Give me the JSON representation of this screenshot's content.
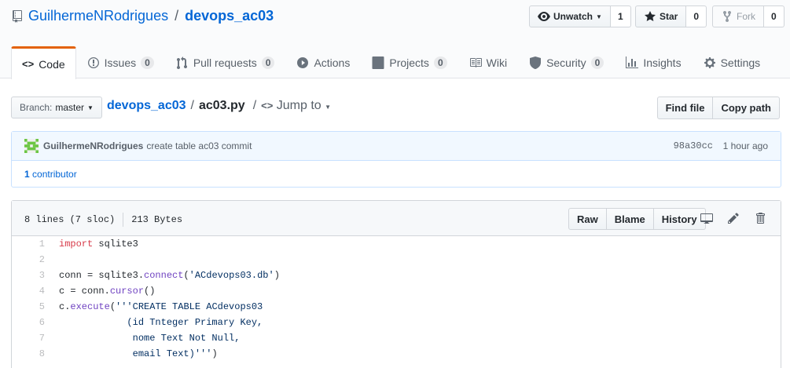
{
  "repo": {
    "owner": "GuilhermeNRodrigues",
    "separator": "/",
    "name": "devops_ac03"
  },
  "actions": {
    "watch": {
      "label": "Unwatch",
      "count": "1"
    },
    "star": {
      "label": "Star",
      "count": "0"
    },
    "fork": {
      "label": "Fork",
      "count": "0"
    }
  },
  "tabs": [
    {
      "label": "Code",
      "icon": "code-icon"
    },
    {
      "label": "Issues",
      "count": "0",
      "icon": "issue-icon"
    },
    {
      "label": "Pull requests",
      "count": "0",
      "icon": "pull-request-icon"
    },
    {
      "label": "Actions",
      "icon": "play-icon"
    },
    {
      "label": "Projects",
      "count": "0",
      "icon": "project-icon"
    },
    {
      "label": "Wiki",
      "icon": "book-icon"
    },
    {
      "label": "Security",
      "count": "0",
      "icon": "shield-icon"
    },
    {
      "label": "Insights",
      "icon": "graph-icon"
    },
    {
      "label": "Settings",
      "icon": "gear-icon"
    }
  ],
  "file_nav": {
    "branch_prefix": "Branch:",
    "branch": "master",
    "repo": "devops_ac03",
    "slash": "/",
    "file": "ac03.py",
    "jump_slash": "/",
    "jump": "Jump to",
    "find_file": "Find file",
    "copy_path": "Copy path"
  },
  "commit": {
    "author": "GuilhermeNRodrigues",
    "message": "create table ac03 commit",
    "sha": "98a30cc",
    "time": "1 hour ago",
    "contributors_count": "1",
    "contributors_label": "contributor"
  },
  "file": {
    "lines_info": "8 lines (7 sloc)",
    "size": "213 Bytes",
    "raw": "Raw",
    "blame": "Blame",
    "history": "History"
  },
  "code": {
    "line_numbers": [
      "1",
      "2",
      "3",
      "4",
      "5",
      "6",
      "7",
      "8"
    ],
    "l1_kw": "import",
    "l1_rest": " sqlite3",
    "l3_a": "conn = sqlite3.",
    "l3_fn": "connect",
    "l3_b": "(",
    "l3_str": "'ACdevops03.db'",
    "l3_c": ")",
    "l4_a": "c = conn.",
    "l4_fn": "cursor",
    "l4_b": "()",
    "l5_a": "c.",
    "l5_fn": "execute",
    "l5_b": "(",
    "l5_str": "'''CREATE TABLE ACdevops03",
    "l6_str": "            (id Tnteger Primary Key,",
    "l7_str": "             nome Text Not Null,",
    "l8_str": "             email Text)'''",
    "l8_c": ")"
  },
  "colors": {
    "accent": "#0366d6",
    "tab_selected_border": "#e36209",
    "keyword": "#d73a49",
    "function": "#6f42c1",
    "string": "#032f62"
  }
}
